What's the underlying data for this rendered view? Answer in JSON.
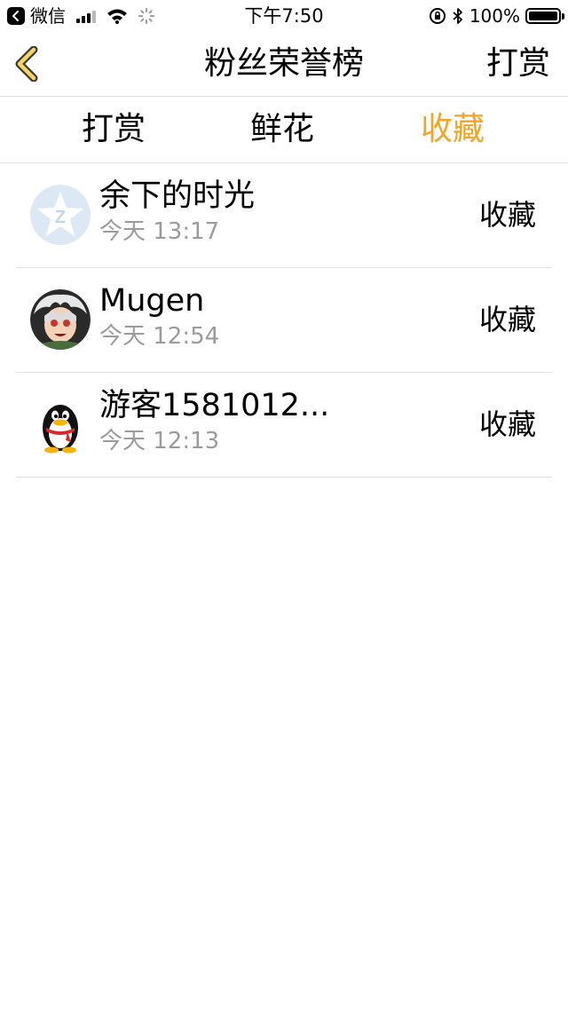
{
  "status_bar": {
    "back_app": "微信",
    "time": "下午7:50",
    "battery": "100%",
    "battery_level": 1.0,
    "icons": [
      "wechat-back-icon",
      "signal-icon",
      "wifi-icon",
      "loading-spinner-icon",
      "orientation-lock-icon",
      "bluetooth-icon",
      "battery-icon"
    ]
  },
  "nav": {
    "title": "粉丝荣誉榜",
    "action": "打赏",
    "back_icon": "chevron-left-icon",
    "accent": "#f0a428"
  },
  "tabs": [
    {
      "label": "打赏",
      "active": false
    },
    {
      "label": "鲜花",
      "active": false
    },
    {
      "label": "收藏",
      "active": true
    }
  ],
  "list": [
    {
      "name": "余下的时光",
      "time": "今天 13:17",
      "action": "收藏",
      "avatar": "qzone-star-avatar"
    },
    {
      "name": "Mugen",
      "time": "今天 12:54",
      "action": "收藏",
      "avatar": "anime-character-avatar"
    },
    {
      "name": "游客1581012...",
      "time": "今天 12:13",
      "action": "收藏",
      "avatar": "qq-penguin-avatar"
    }
  ]
}
